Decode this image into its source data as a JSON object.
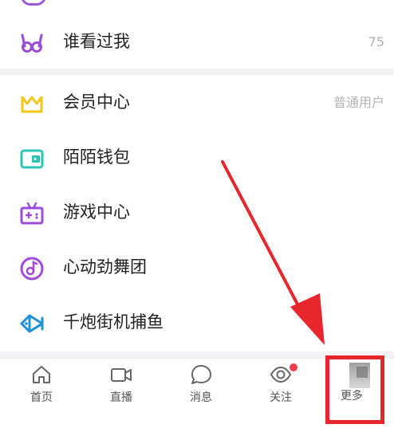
{
  "menu": [
    {
      "label": "谁看过我",
      "right": "75",
      "icon": "glasses-icon",
      "color": "#9b4bd9"
    },
    {
      "label": "会员中心",
      "right": "普通用户",
      "icon": "crown-icon",
      "color": "#f5c518"
    },
    {
      "label": "陌陌钱包",
      "right": "",
      "icon": "wallet-icon",
      "color": "#2bc4b6"
    },
    {
      "label": "游戏中心",
      "right": "",
      "icon": "gamepad-icon",
      "color": "#9b4bd9"
    },
    {
      "label": "心动劲舞团",
      "right": "",
      "icon": "music-disc-icon",
      "color": "#a24be0"
    },
    {
      "label": "千炮街机捕鱼",
      "right": "",
      "icon": "fish-icon",
      "color": "#1f8fd8"
    }
  ],
  "tabs": [
    {
      "label": "首页",
      "icon": "home-icon"
    },
    {
      "label": "直播",
      "icon": "video-camera-icon"
    },
    {
      "label": "消息",
      "icon": "chat-bubble-icon"
    },
    {
      "label": "关注",
      "icon": "eye-icon",
      "badge": true
    },
    {
      "label": "更多",
      "icon": "more-icon"
    }
  ],
  "colors": {
    "highlight": "#e8262e",
    "separator": "#f1f1f4"
  }
}
